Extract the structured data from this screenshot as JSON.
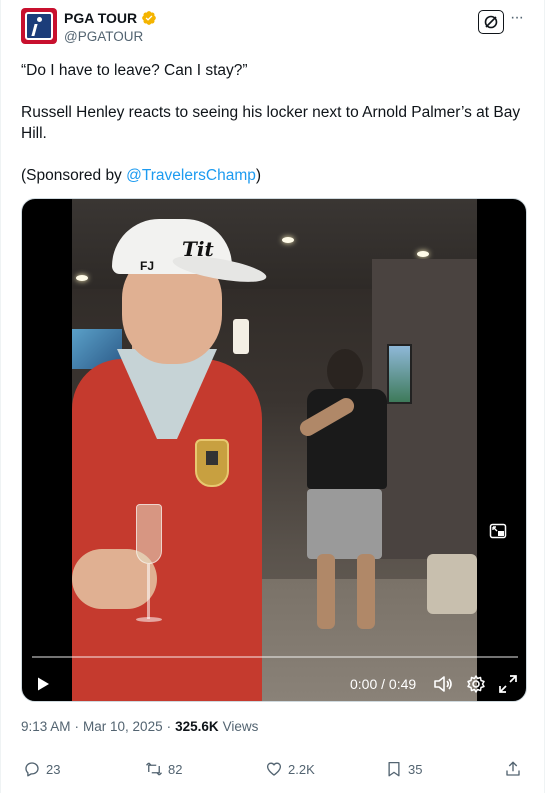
{
  "account": {
    "name": "PGA TOUR",
    "handle": "@PGATOUR",
    "verified": true,
    "verified_color": "#f4b400"
  },
  "header_actions": {
    "grok_icon": "grok-icon",
    "more_label": "···"
  },
  "tweet": {
    "line1": "“Do I have to leave? Can I stay?”",
    "line2": "Russell Henley reacts to seeing his locker next to Arnold Palmer’s at Bay Hill.",
    "sponsor_prefix": "(Sponsored by ",
    "sponsor_mention": "@TravelersChamp",
    "sponsor_suffix": ")"
  },
  "video": {
    "progress": 0,
    "time": "0:00 / 0:49",
    "controls": [
      "play-icon",
      "volume-icon",
      "settings-icon",
      "fullscreen-icon",
      "pip-icon"
    ]
  },
  "meta": {
    "time": "9:13 AM",
    "sep1": "·",
    "date": "Mar 10, 2025",
    "sep2": "·",
    "views_count": "325.6K",
    "views_label": "Views"
  },
  "actions": {
    "replies": "23",
    "reposts": "82",
    "likes": "2.2K",
    "bookmarks": "35"
  },
  "colors": {
    "text": "#0f1419",
    "secondary": "#536471",
    "link": "#1d9bf0",
    "brand_red": "#c8102e"
  }
}
